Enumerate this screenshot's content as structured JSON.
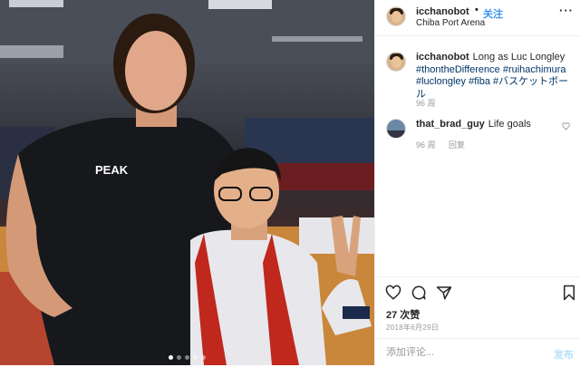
{
  "post": {
    "username": "icchanobot",
    "follow_label": "关注",
    "separator": "•",
    "location": "Chiba Port Arena",
    "more_label": "···"
  },
  "caption": {
    "username": "icchanobot",
    "text": "Long as Luc Longley",
    "hashtags": "#thontheDifference #ruihachimura #luclongley #fiba #バスケットボール",
    "hashtag_list": [
      "#thontheDifference",
      "#ruihachimura",
      "#luclongley",
      "#fiba",
      "#バスケットボール"
    ],
    "age": "96 周"
  },
  "comments": [
    {
      "username": "that_brad_guy",
      "text": "Life goals",
      "age": "96 周",
      "reply_label": "回复"
    }
  ],
  "actions": {
    "like_icon": "heart-icon",
    "comment_icon": "comment-icon",
    "share_icon": "share-icon",
    "save_icon": "bookmark-icon"
  },
  "likes_label": "27 次赞",
  "date_label": "2018年6月29日",
  "add_comment": {
    "placeholder": "添加评论...",
    "post_label": "发布"
  },
  "carousel": {
    "count": 5,
    "active": 0
  },
  "colors": {
    "link": "#3897f0",
    "hashtag": "#003569",
    "muted": "#999999",
    "post_disabled": "#b2dffc"
  }
}
